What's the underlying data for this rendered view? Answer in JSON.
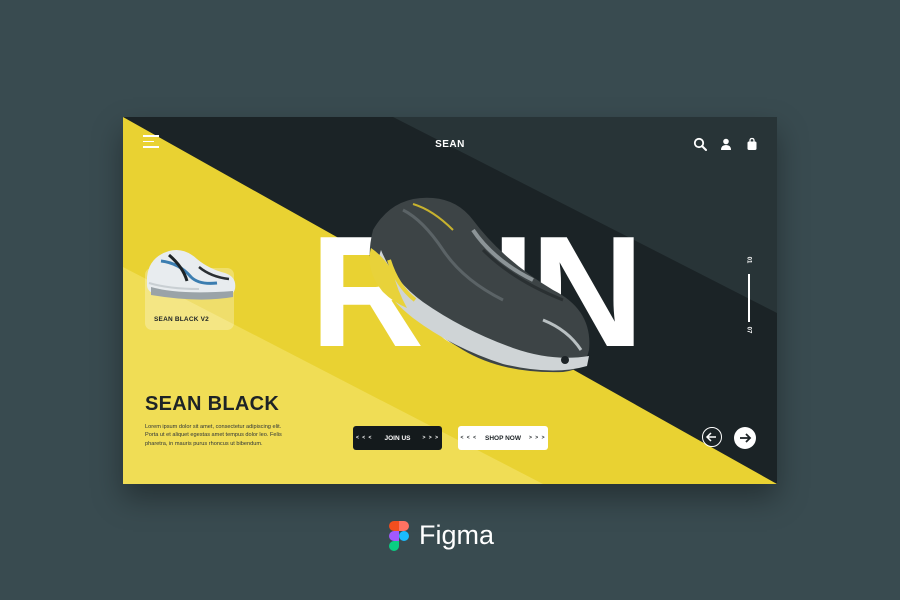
{
  "header": {
    "brand": "SEAN",
    "menu_icon": "hamburger-menu-icon",
    "icons": [
      "search-icon",
      "user-icon",
      "shopping-bag-icon"
    ]
  },
  "hero": {
    "big_word": "RUN"
  },
  "thumbnail": {
    "label": "SEAN BLACK V2"
  },
  "product": {
    "title": "SEAN BLACK",
    "description": "Lorem ipsum dolor sit amet, consectetur adipiscing elit. Porta ut et aliquet egestas amet tempus dolor leo. Felis pharetra, in mauris purus rhoncus ut bibendum."
  },
  "buttons": {
    "join": {
      "left_arrows": "< < <",
      "label": "JOIN US",
      "right_arrows": "> > >"
    },
    "shop": {
      "left_arrows": "< < <",
      "label": "SHOP NOW",
      "right_arrows": "> > >"
    }
  },
  "slider": {
    "current": "01",
    "total": "07"
  },
  "navigation": {
    "prev_icon": "arrow-left-icon",
    "next_icon": "arrow-right-icon"
  },
  "footer": {
    "tool_name": "Figma",
    "logo_icon": "figma-logo-icon"
  },
  "colors": {
    "background": "#394b50",
    "card_dark": "#1b2326",
    "accent_yellow": "#e9d232",
    "light_yellow": "#f0dd55"
  }
}
